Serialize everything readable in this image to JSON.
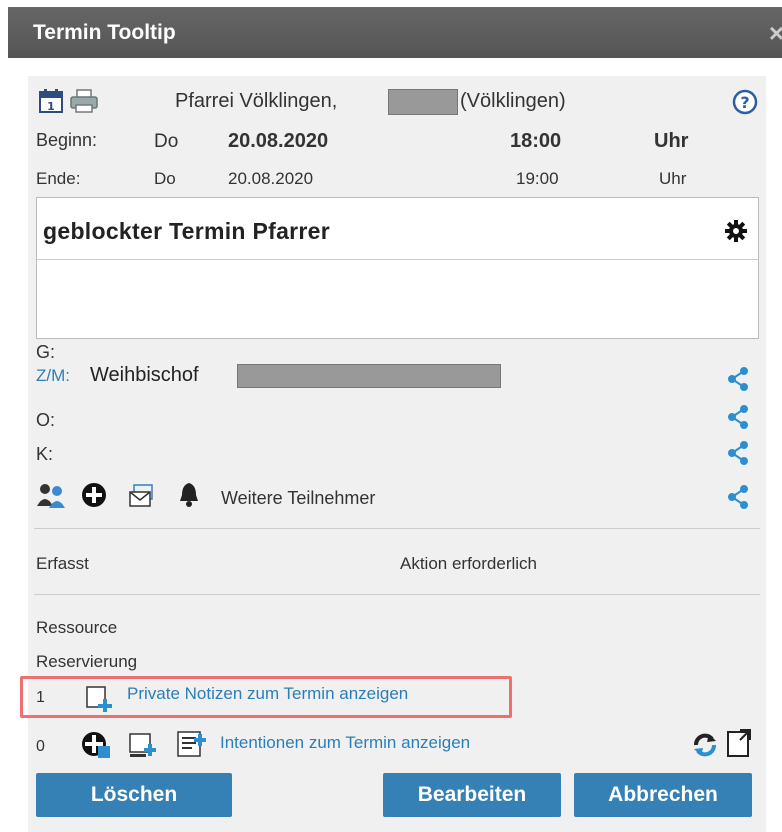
{
  "window": {
    "title": "Termin Tooltip",
    "close": "×"
  },
  "header": {
    "parish": "Pfarrei Völklingen,",
    "location": "(Völklingen)"
  },
  "begin": {
    "label": "Beginn:",
    "day": "Do",
    "date": "20.08.2020",
    "time": "18:00",
    "unit": "Uhr"
  },
  "end": {
    "label": "Ende:",
    "day": "Do",
    "date": "20.08.2020",
    "time": "19:00",
    "unit": "Uhr"
  },
  "subject": "geblockter Termin Pfarrer",
  "fields": {
    "g": "G:",
    "zm": "Z/M:",
    "zm_value": "Weihbischof",
    "o": "O:",
    "k": "K:"
  },
  "participants": {
    "more": "Weitere Teilnehmer"
  },
  "status": {
    "captured": "Erfasst",
    "action": "Aktion erforderlich"
  },
  "resource": {
    "ressource": "Ressource",
    "reservierung": "Reservierung"
  },
  "notes": {
    "count": "1",
    "link": "Private Notizen zum Termin anzeigen"
  },
  "intentions": {
    "count": "0",
    "link": "Intentionen zum Termin anzeigen"
  },
  "buttons": {
    "delete": "Löschen",
    "edit": "Bearbeiten",
    "cancel": "Abbrechen"
  },
  "colors": {
    "accent": "#3580b4",
    "link": "#2b7fb6",
    "titlebar": "#5c5c5c",
    "highlight": "#ee6f6f"
  }
}
